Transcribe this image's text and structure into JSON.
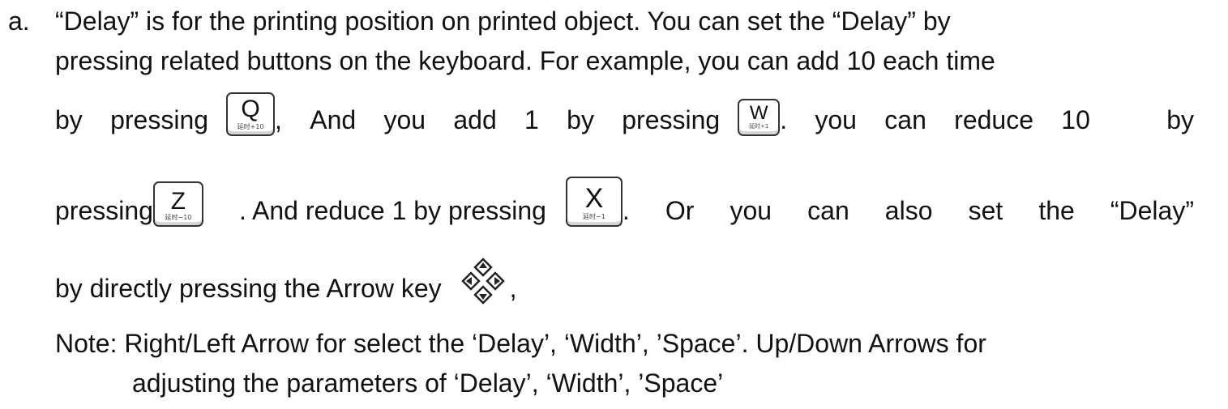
{
  "item": {
    "marker": "a.",
    "line1": "“Delay” is for the printing position on printed object. You can set the “Delay” by",
    "line2": "pressing related buttons on the keyboard. For example, you can add 10 each  time",
    "line3": {
      "w1": "by",
      "w2": "pressing",
      "w3": ",",
      "w4": "And",
      "w5": "you",
      "w6": "add",
      "w7": "1",
      "w8": "by",
      "w9": "pressing",
      "w10": ".",
      "w11": "you",
      "w12": "can",
      "w13": "reduce",
      "w14": "10",
      "w15": "by"
    },
    "line4": {
      "w1": "pressing",
      "w2": ". And reduce 1 by pressing",
      "w3": ".",
      "w4": "Or",
      "w5": "you",
      "w6": "can",
      "w7": "also",
      "w8": "set",
      "w9": "the",
      "w10": "“Delay”"
    },
    "line5": {
      "before": "by directly pressing the Arrow key",
      "after": ","
    },
    "note1": "Note: Right/Left Arrow for select the ‘Delay’, ‘Width’, ’Space’. Up/Down Arrows for",
    "note2": "adjusting the parameters of ‘Delay’, ‘Width’, ’Space’"
  },
  "keys": {
    "q": {
      "cap": "Q",
      "sub": "延时+10"
    },
    "w": {
      "cap": "W",
      "sub": "延时+1"
    },
    "z": {
      "cap": "Z",
      "sub": "延时−10"
    },
    "x": {
      "cap": "X",
      "sub": "延时−1"
    }
  },
  "icons": {
    "arrow_key": "arrow-key-icon"
  },
  "colors": {
    "text": "#111111",
    "key_border": "#333333"
  }
}
